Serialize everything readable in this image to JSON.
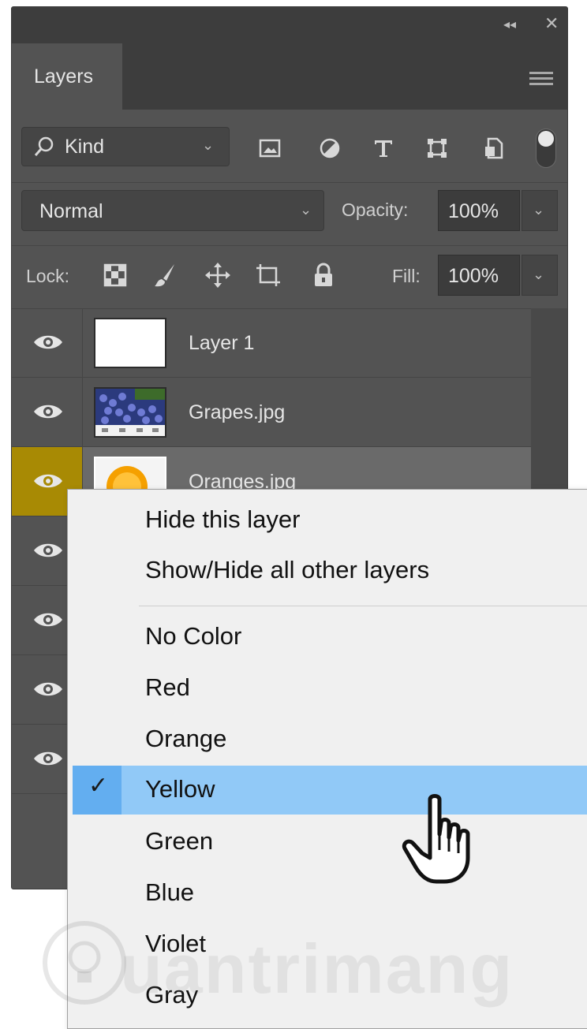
{
  "panel": {
    "collapse_glyph": "◂◂",
    "close_glyph": "✕",
    "tab_label": "Layers",
    "filter": {
      "kind_label": "Kind",
      "icons": [
        "image-filter-icon",
        "adjustment-filter-icon",
        "type-filter-icon",
        "shape-filter-icon",
        "smart-object-filter-icon"
      ]
    },
    "blend": {
      "mode": "Normal",
      "opacity_label": "Opacity:",
      "opacity_value": "100%"
    },
    "lock": {
      "label": "Lock:",
      "fill_label": "Fill:",
      "fill_value": "100%",
      "icons": [
        "lock-transparent-pixels-icon",
        "lock-image-pixels-icon",
        "lock-position-icon",
        "lock-artboard-icon",
        "lock-all-icon"
      ]
    },
    "layers": [
      {
        "name": "Layer 1",
        "selected": false
      },
      {
        "name": "Grapes.jpg",
        "selected": false
      },
      {
        "name": "Oranges.jpg",
        "selected": true
      }
    ]
  },
  "context_menu": {
    "items": [
      {
        "label": "Hide this layer"
      },
      {
        "label": "Show/Hide all other layers"
      },
      {
        "label": "No Color"
      },
      {
        "label": "Red"
      },
      {
        "label": "Orange"
      },
      {
        "label": "Yellow",
        "checked": true
      },
      {
        "label": "Green"
      },
      {
        "label": "Blue"
      },
      {
        "label": "Violet"
      },
      {
        "label": "Gray"
      }
    ],
    "check_glyph": "✓"
  },
  "colors": {
    "panel_bg": "#535353",
    "selected_eye_bg": "#a88a04",
    "menu_highlight": "#91c9f7",
    "menu_check_cell": "#63aef0"
  },
  "watermark": {
    "text": "uantrimang"
  }
}
